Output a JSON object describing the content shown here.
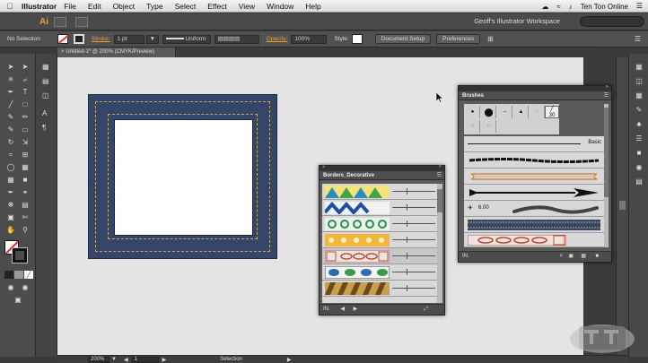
{
  "menubar": {
    "app_name": "Illustrator",
    "items": [
      "File",
      "Edit",
      "Object",
      "Type",
      "Select",
      "Effect",
      "View",
      "Window",
      "Help"
    ],
    "user": "Ten Ton Online"
  },
  "appbar": {
    "logo": "Ai",
    "workspace": "Geoff's Illustrator Workspace"
  },
  "controlbar": {
    "selection": "No Selection",
    "stroke_label": "Stroke:",
    "stroke_value": "1 pt",
    "profile": "Uniform",
    "opacity_label": "Opacity:",
    "opacity_value": "100%",
    "style_label": "Style:",
    "document_setup": "Document Setup",
    "preferences": "Preferences"
  },
  "document": {
    "tab_title": "Untitled-1* @ 200% (CMYK/Preview)"
  },
  "borders_panel": {
    "title": "Borders_Decorative",
    "footer": "IN."
  },
  "brushes_panel": {
    "title": "Brushes",
    "tip_size": "30",
    "basic_label": "Basic",
    "calligraphic_size": "6.00",
    "footer": "IN."
  },
  "statusbar": {
    "zoom": "200%",
    "page": "1",
    "tool": "Selection"
  },
  "colors": {
    "accent_orange": "#e7a03a",
    "denim": "#34466c",
    "canvas": "#e4e4e4"
  }
}
